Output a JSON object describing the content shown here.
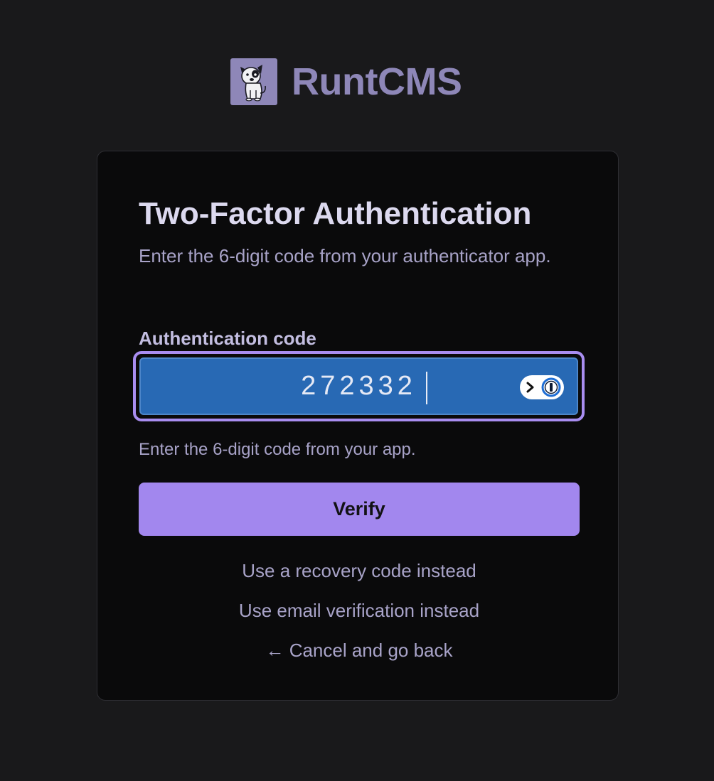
{
  "brand": {
    "name": "RuntCMS",
    "logo_icon": "dog-logo-icon",
    "color": "#8e87b8"
  },
  "card": {
    "title": "Two-Factor Authentication",
    "subtitle": "Enter the 6-digit code from your authenticator app.",
    "field": {
      "label": "Authentication code",
      "value": "272332",
      "helper": "Enter the 6-digit code from your app.",
      "password_manager_icon": "password-manager-key-icon"
    },
    "verify_label": "Verify",
    "links": {
      "recovery": "Use a recovery code instead",
      "email": "Use email verification instead",
      "cancel": "← Cancel and go back"
    }
  },
  "colors": {
    "background": "#19191b",
    "card_background": "#0a0a0b",
    "accent": "#a287ee",
    "input_autofill": "#2869b4",
    "focus_ring": "#a88df0"
  }
}
